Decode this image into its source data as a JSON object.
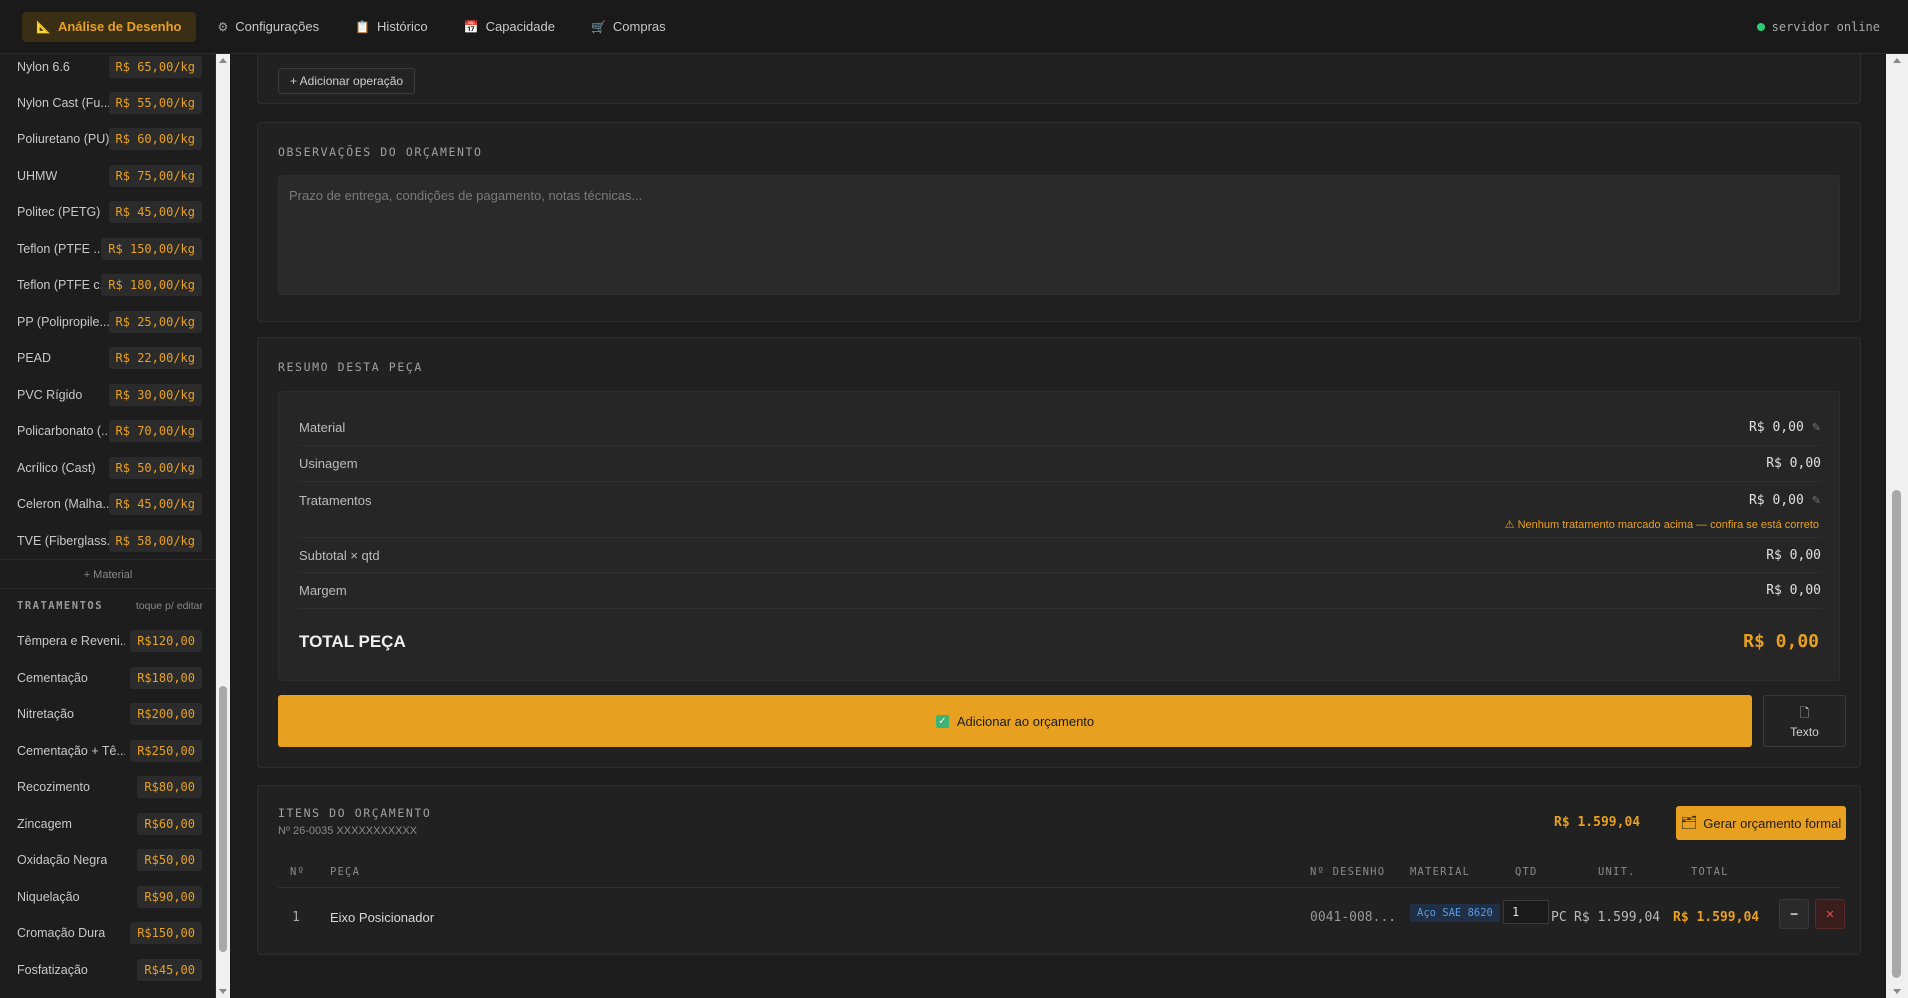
{
  "tabs": [
    {
      "label": "Análise de Desenho",
      "icon": "ruler-icon",
      "glyph": "📐"
    },
    {
      "label": "Configurações",
      "icon": "gear-icon",
      "glyph": "⚙"
    },
    {
      "label": "Histórico",
      "icon": "clipboard-icon",
      "glyph": "📋"
    },
    {
      "label": "Capacidade",
      "icon": "calendar-icon",
      "glyph": "📅"
    },
    {
      "label": "Compras",
      "icon": "cart-icon",
      "glyph": "🛒"
    }
  ],
  "server_status": "servidor online",
  "materials": [
    {
      "name": "Nylon 6.6",
      "price": "R$ 65,00/kg"
    },
    {
      "name": "Nylon Cast (Fu...",
      "price": "R$ 55,00/kg"
    },
    {
      "name": "Poliuretano (PU)",
      "price": "R$ 60,00/kg"
    },
    {
      "name": "UHMW",
      "price": "R$ 75,00/kg"
    },
    {
      "name": "Politec (PETG)",
      "price": "R$ 45,00/kg"
    },
    {
      "name": "Teflon (PTFE ...",
      "price": "R$ 150,00/kg"
    },
    {
      "name": "Teflon (PTFE c...",
      "price": "R$ 180,00/kg"
    },
    {
      "name": "PP (Polipropile...",
      "price": "R$ 25,00/kg"
    },
    {
      "name": "PEAD",
      "price": "R$ 22,00/kg"
    },
    {
      "name": "PVC Rígido",
      "price": "R$ 30,00/kg"
    },
    {
      "name": "Policarbonato (...",
      "price": "R$ 70,00/kg"
    },
    {
      "name": "Acrílico (Cast)",
      "price": "R$ 50,00/kg"
    },
    {
      "name": "Celeron (Malha...",
      "price": "R$ 45,00/kg"
    },
    {
      "name": "TVE (Fiberglass...",
      "price": "R$ 58,00/kg"
    }
  ],
  "add_material_label": "+ Material",
  "treatments_title": "TRATAMENTOS",
  "treatments_hint": "toque p/ editar",
  "treatments": [
    {
      "name": "Têmpera e Reveni...",
      "price": "R$120,00"
    },
    {
      "name": "Cementação",
      "price": "R$180,00"
    },
    {
      "name": "Nitretação",
      "price": "R$200,00"
    },
    {
      "name": "Cementação + Tê...",
      "price": "R$250,00"
    },
    {
      "name": "Recozimento",
      "price": "R$80,00"
    },
    {
      "name": "Zincagem",
      "price": "R$60,00"
    },
    {
      "name": "Oxidação Negra",
      "price": "R$50,00"
    },
    {
      "name": "Niquelação",
      "price": "R$90,00"
    },
    {
      "name": "Cromação Dura",
      "price": "R$150,00"
    },
    {
      "name": "Fosfatização",
      "price": "R$45,00"
    }
  ],
  "add_operation_label": "+ Adicionar operação",
  "observations": {
    "title": "OBSERVAÇÕES DO ORÇAMENTO",
    "placeholder": "Prazo de entrega, condições de pagamento, notas técnicas..."
  },
  "summary": {
    "title": "RESUMO DESTA PEÇA",
    "rows": [
      {
        "label": "Material",
        "value": "R$ 0,00"
      },
      {
        "label": "Usinagem",
        "value": "R$ 0,00"
      },
      {
        "label": "Tratamentos",
        "value": "R$ 0,00"
      },
      {
        "label": "Subtotal × qtd",
        "value": "R$ 0,00"
      },
      {
        "label": "Margem",
        "value": "R$ 0,00"
      }
    ],
    "warning": "⚠ Nenhum tratamento marcado acima — confira se está correto",
    "total_label": "TOTAL PEÇA",
    "total_value": "R$ 0,00",
    "add_button": "Adicionar ao orçamento",
    "text_button": "Texto"
  },
  "items": {
    "title": "ITENS DO ORÇAMENTO",
    "number": "Nº 26-0035 XXXXXXXXXXX",
    "total": "R$ 1.599,04",
    "generate_button": "Gerar orçamento formal",
    "columns": [
      "Nº",
      "PEÇA",
      "Nº DESENHO",
      "MATERIAL",
      "QTD",
      "UNIT.",
      "TOTAL"
    ],
    "rows": [
      {
        "n": "1",
        "part": "Eixo Posicionador",
        "drawing": "0041-008...",
        "material": "Aço SAE 8620",
        "qty": "1",
        "unit_label": "PC",
        "unit": "R$ 1.599,04",
        "total": "R$ 1.599,04"
      }
    ]
  },
  "colors": {
    "accent": "#e8a020",
    "online": "#2ecc71",
    "danger": "#e05050",
    "badge": "#5a9be0"
  }
}
